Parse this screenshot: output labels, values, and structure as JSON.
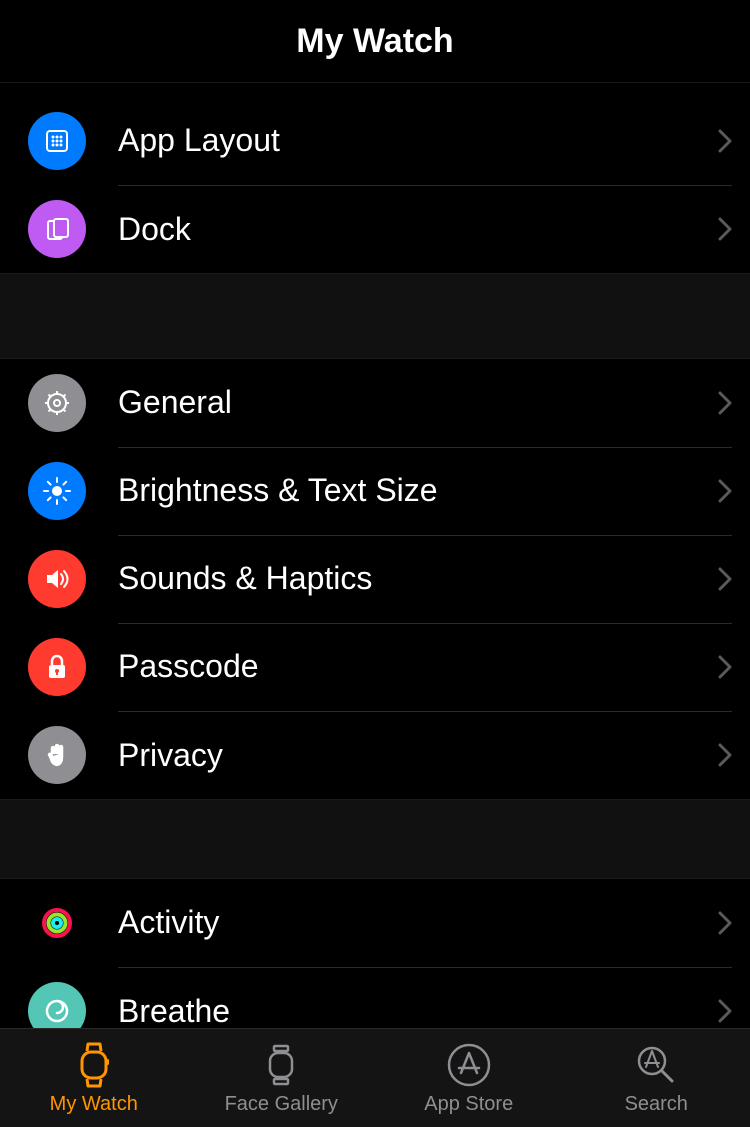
{
  "header": {
    "title": "My Watch"
  },
  "sections": [
    {
      "rows": [
        {
          "id": "app-layout",
          "label": "App Layout",
          "icon": "app-layout-icon",
          "bg": "#007aff"
        },
        {
          "id": "dock",
          "label": "Dock",
          "icon": "dock-icon",
          "bg": "#bf5af2"
        }
      ]
    },
    {
      "rows": [
        {
          "id": "general",
          "label": "General",
          "icon": "gear-icon",
          "bg": "#8e8e93"
        },
        {
          "id": "brightness",
          "label": "Brightness & Text Size",
          "icon": "brightness-icon",
          "bg": "#007aff"
        },
        {
          "id": "sounds",
          "label": "Sounds & Haptics",
          "icon": "speaker-icon",
          "bg": "#ff3b30"
        },
        {
          "id": "passcode",
          "label": "Passcode",
          "icon": "lock-icon",
          "bg": "#ff3b30"
        },
        {
          "id": "privacy",
          "label": "Privacy",
          "icon": "hand-icon",
          "bg": "#8e8e93"
        }
      ]
    },
    {
      "rows": [
        {
          "id": "activity",
          "label": "Activity",
          "icon": "activity-icon",
          "bg": "#000000"
        },
        {
          "id": "breathe",
          "label": "Breathe",
          "icon": "breathe-icon",
          "bg": "#54c6b6"
        }
      ]
    }
  ],
  "tabs": [
    {
      "id": "my-watch",
      "label": "My Watch",
      "icon": "watch-tab-icon",
      "active": true
    },
    {
      "id": "face-gallery",
      "label": "Face Gallery",
      "icon": "face-tab-icon",
      "active": false
    },
    {
      "id": "app-store",
      "label": "App Store",
      "icon": "appstore-tab-icon",
      "active": false
    },
    {
      "id": "search",
      "label": "Search",
      "icon": "search-tab-icon",
      "active": false
    }
  ],
  "colors": {
    "accent": "#ff9500",
    "inactive": "#8e8e93"
  }
}
